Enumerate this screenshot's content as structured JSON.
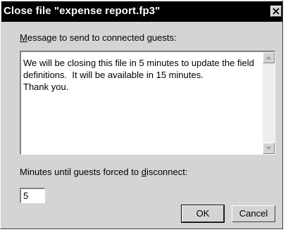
{
  "dialog": {
    "title": "Close file \"expense report.fp3\"",
    "close_glyph": "×"
  },
  "message": {
    "label_accel": "M",
    "label_rest": "essage to send to connected guests:",
    "text": "We will be closing this file in 5 minutes to update the field definitions.  It will be available in 15 minutes.\nThank you."
  },
  "minutes": {
    "label_prefix": "Minutes until guests forced to ",
    "label_accel": "d",
    "label_suffix": "isconnect:",
    "value": "5"
  },
  "buttons": {
    "ok": "OK",
    "cancel": "Cancel"
  },
  "icons": {
    "close": "close-icon",
    "scroll_up": "arrow-up-icon",
    "scroll_down": "arrow-down-icon"
  }
}
